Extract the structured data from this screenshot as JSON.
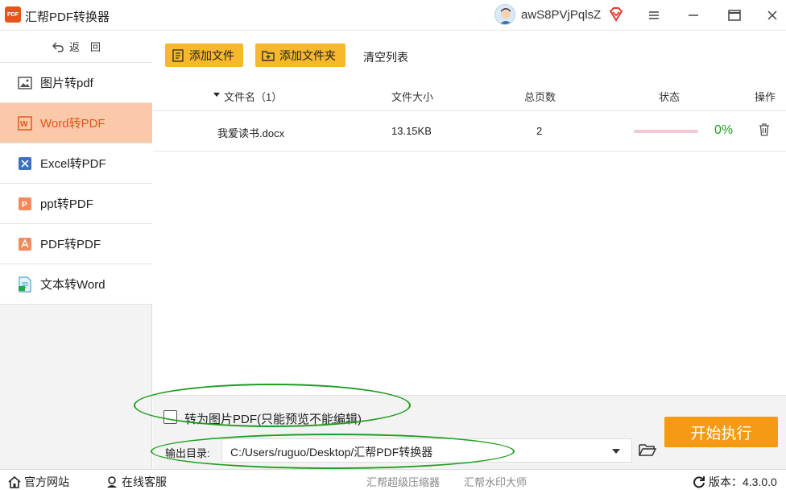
{
  "window": {
    "logo_text": "PDF",
    "title": "汇帮PDF转换器",
    "user_name": "awS8PVjPqlsZ"
  },
  "sidebar": {
    "back_label": "返　回",
    "items": [
      {
        "label": "图片转pdf",
        "icon": "image-icon"
      },
      {
        "label": "Word转PDF",
        "icon": "word-icon",
        "active": true
      },
      {
        "label": "Excel转PDF",
        "icon": "excel-icon"
      },
      {
        "label": "ppt转PDF",
        "icon": "ppt-icon"
      },
      {
        "label": "PDF转PDF",
        "icon": "pdf-icon"
      },
      {
        "label": "文本转Word",
        "icon": "text-icon"
      }
    ]
  },
  "toolbar": {
    "add_file": "添加文件",
    "add_folder": "添加文件夹",
    "clear_list": "清空列表"
  },
  "table": {
    "headers": {
      "filename": "文件名（1）",
      "size": "文件大小",
      "pages": "总页数",
      "status": "状态",
      "action": "操作"
    },
    "rows": [
      {
        "filename": "我爱读书.docx",
        "size": "13.15KB",
        "pages": "2",
        "progress_text": "0%",
        "progress": 0
      }
    ]
  },
  "options": {
    "image_pdf_label": "转为图片PDF(只能预览不能编辑)",
    "output_label": "输出目录:",
    "output_path": "C:/Users/ruguo/Desktop/汇帮PDF转换器",
    "start_label": "开始执行"
  },
  "statusbar": {
    "official_site": "官方网站",
    "online_service": "在线客服",
    "compressor": "汇帮超级压缩器",
    "watermark": "汇帮水印大师",
    "version": "版本：4.3.0.0"
  },
  "colors": {
    "accent": "#e8541c",
    "button_yellow": "#f7b82b",
    "start_orange": "#f59a12",
    "active_bg": "#f9c9aa",
    "progress_green": "#1e9e1e",
    "annotation_green": "#1e9e1e"
  }
}
